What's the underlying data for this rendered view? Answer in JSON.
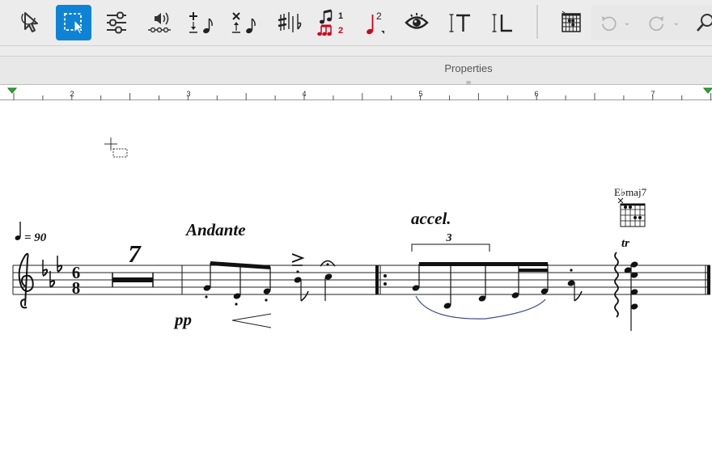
{
  "toolbar": {
    "tools": [
      {
        "name": "selection-tool",
        "icon": "arrow-cursor-icon"
      },
      {
        "name": "marquee-selection-tool",
        "icon": "marquee-select-icon",
        "active": true
      },
      {
        "name": "mixer-tool",
        "icon": "sliders-icon"
      },
      {
        "name": "playback-tool",
        "icon": "speaker-icon"
      },
      {
        "name": "add-note-tool",
        "icon": "add-note-icon"
      },
      {
        "name": "delete-note-tool",
        "icon": "delete-note-icon"
      },
      {
        "name": "accidentals-tool",
        "icon": "sharp-flat-icon"
      },
      {
        "name": "tuplet-voice-tool",
        "icon": "voices-icon",
        "label1": "1",
        "label2": "2"
      },
      {
        "name": "voice-2-tool",
        "icon": "voice-note-icon",
        "label": "2"
      },
      {
        "name": "view-tool",
        "icon": "eye-icon"
      },
      {
        "name": "text-tool",
        "icon": "text-cursor-icon"
      },
      {
        "name": "lyrics-tool",
        "icon": "lyrics-cursor-icon"
      },
      {
        "name": "chord-diagram-tool",
        "icon": "chord-grid-icon"
      },
      {
        "name": "undo-button",
        "icon": "undo-icon"
      },
      {
        "name": "redo-button",
        "icon": "redo-icon"
      },
      {
        "name": "search-button",
        "icon": "magnifier-icon"
      }
    ],
    "accent": "#0e83d6"
  },
  "properties": {
    "label": "Properties"
  },
  "ruler": {
    "labels": [
      "2",
      "3",
      "4",
      "5",
      "6",
      "7"
    ]
  },
  "score": {
    "tempo_value": "= 90",
    "tempo_text": "Andante",
    "multirest_count": "7",
    "dynamic": "pp",
    "accel": "accel.",
    "tuplet_number": "3",
    "chord_symbol": "E♭maj7",
    "trill": "tr",
    "time_signature_top": "6",
    "time_signature_bottom": "8"
  }
}
